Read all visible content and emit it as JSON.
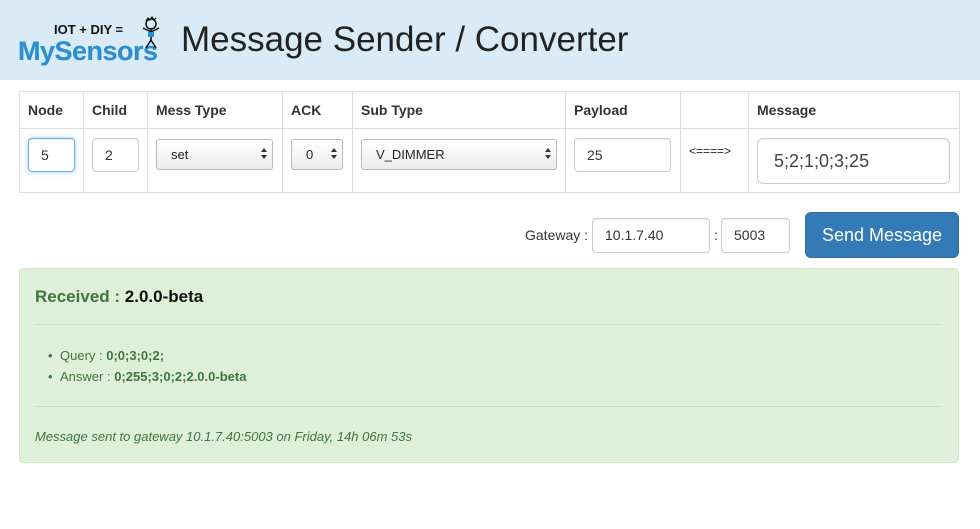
{
  "header": {
    "logo_top": "IOT + DIY =",
    "logo_main": "MySensors",
    "title": "Message Sender / Converter",
    "bg_color": "#d9ebf7"
  },
  "table": {
    "headers": [
      "Node",
      "Child",
      "Mess Type",
      "ACK",
      "Sub Type",
      "Payload",
      "",
      "Message"
    ],
    "node": "5",
    "child": "2",
    "mess_type": "set",
    "ack": "0",
    "sub_type": "V_DIMMER",
    "payload": "25",
    "convert_arrow": "<====>",
    "message": "5;2;1;0;3;25"
  },
  "gateway": {
    "label": "Gateway :",
    "ip": "10.1.7.40",
    "colon": ":",
    "port": "5003",
    "send_label": "Send Message",
    "accent": "#337ab7"
  },
  "result": {
    "received_label": "Received :",
    "received_version": "2.0.0-beta",
    "items": [
      {
        "label": "Query   :",
        "value": "0;0;3;0;2;"
      },
      {
        "label": "Answer :",
        "value": "0;255;3;0;2;2.0.0-beta"
      }
    ],
    "status": "Message sent to gateway 10.1.7.40:5003 on Friday, 14h 06m 53s",
    "bg_color": "#dff0d8",
    "text_color": "#3c763d"
  }
}
